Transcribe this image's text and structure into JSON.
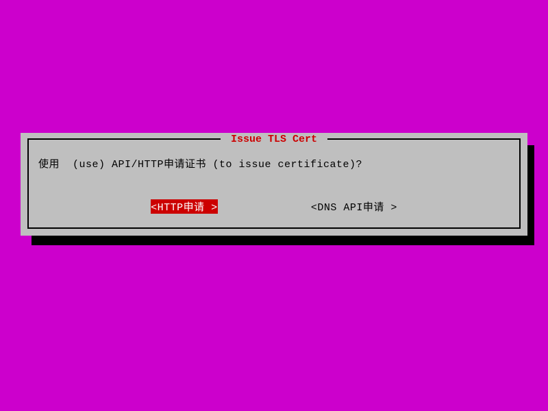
{
  "dialog": {
    "title": " Issue TLS Cert ",
    "prompt": "使用  (use) API/HTTP申请证书 (to issue certificate)?",
    "buttons": {
      "http": "<HTTP申请 >",
      "dns": "<DNS API申请 >"
    }
  }
}
